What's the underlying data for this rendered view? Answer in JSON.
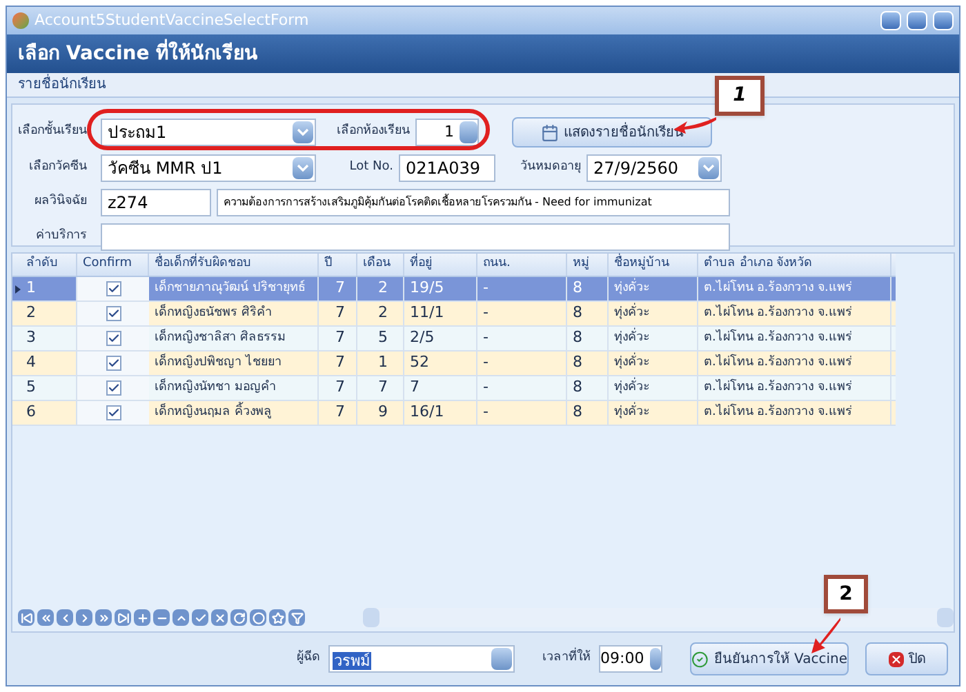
{
  "window": {
    "title": "Account5StudentVaccineSelectForm"
  },
  "header": {
    "title": "เลือก Vaccine ที่ให้นักเรียน"
  },
  "group_tab": {
    "label": "รายชื่อนักเรียน"
  },
  "form": {
    "grade": {
      "label": "เลือกชั้นเรียน",
      "value": "ประถม1"
    },
    "room": {
      "label": "เลือกห้องเรียน",
      "value": "1"
    },
    "show_button": {
      "label": "แสดงรายชื่อนักเรียน"
    },
    "vaccine": {
      "label": "เลือกวัคซีน",
      "value": "วัคซีน MMR ป1"
    },
    "lot": {
      "label": "Lot No.",
      "value": "021A039"
    },
    "expiry": {
      "label": "วันหมดอายุ",
      "value": "27/9/2560"
    },
    "diagnosis": {
      "label": "ผลวินิจฉัย",
      "code": "z274",
      "text": "ความต้องการการสร้างเสริมภูมิคุ้มกันต่อโรคติดเชื้อหลายโรครวมกัน - Need for immunizat"
    },
    "service": {
      "label": "ค่าบริการ"
    }
  },
  "table": {
    "columns": [
      "ลำดับ",
      "Confirm",
      "ชื่อเด็กที่รับผิดชอบ",
      "ปี",
      "เดือน",
      "ที่อยู่",
      "ถนน.",
      "หมู่",
      "ชื่อหมู่บ้าน",
      "ตำบล อำเภอ จังหวัด"
    ],
    "rows": [
      {
        "selected": true,
        "confirmed": true,
        "cells": [
          "1",
          "",
          "เด็กชายภาณุวัฒน์ ปริชายุทธ์",
          "7",
          "2",
          "19/5",
          "-",
          "8",
          "ทุ่งคั่วะ",
          "ต.ไผ่โทน อ.ร้องกวาง จ.แพร่"
        ]
      },
      {
        "selected": false,
        "confirmed": true,
        "cells": [
          "2",
          "",
          "เด็กหญิงธนัชพร ศิริคำ",
          "7",
          "2",
          "11/1",
          "-",
          "8",
          "ทุ่งคั่วะ",
          "ต.ไผ่โทน อ.ร้องกวาง จ.แพร่"
        ]
      },
      {
        "selected": false,
        "confirmed": true,
        "cells": [
          "3",
          "",
          "เด็กหญิงชาลิสา ศิลธรรม",
          "7",
          "5",
          "2/5",
          "-",
          "8",
          "ทุ่งคั่วะ",
          "ต.ไผ่โทน อ.ร้องกวาง จ.แพร่"
        ]
      },
      {
        "selected": false,
        "confirmed": true,
        "cells": [
          "4",
          "",
          "เด็กหญิงปพิชญา ไชยยา",
          "7",
          "1",
          "52",
          "-",
          "8",
          "ทุ่งคั่วะ",
          "ต.ไผ่โทน อ.ร้องกวาง จ.แพร่"
        ]
      },
      {
        "selected": false,
        "confirmed": true,
        "cells": [
          "5",
          "",
          "เด็กหญิงนัทชา มอญคำ",
          "7",
          "7",
          "7",
          "-",
          "8",
          "ทุ่งคั่วะ",
          "ต.ไผ่โทน อ.ร้องกวาง จ.แพร่"
        ]
      },
      {
        "selected": false,
        "confirmed": true,
        "cells": [
          "6",
          "",
          "เด็กหญิงนฤมล คิ้วงพลู",
          "7",
          "9",
          "16/1",
          "-",
          "8",
          "ทุ่งคั่วะ",
          "ต.ไผ่โทน อ.ร้องกวาง จ.แพร่"
        ]
      }
    ]
  },
  "footer": {
    "injector": {
      "label": "ผู้ฉีด",
      "value": "วรพม์"
    },
    "time": {
      "label": "เวลาที่ให้",
      "value": "09:00"
    },
    "confirm_button": {
      "label": "ยืนยันการให้ Vaccine"
    },
    "close_button": {
      "label": "ปิด"
    }
  },
  "callouts": [
    "1",
    "2"
  ]
}
